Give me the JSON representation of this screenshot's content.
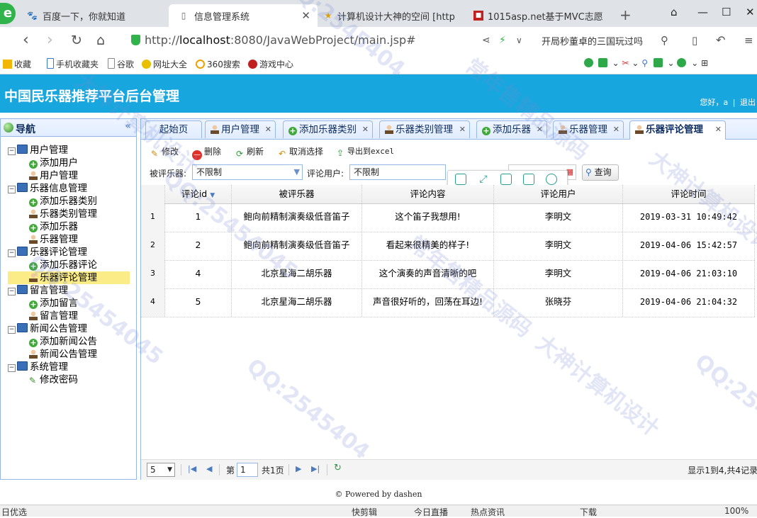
{
  "browser": {
    "tabs": [
      {
        "title": "百度一下，你就知道",
        "icon": "paw-icon"
      },
      {
        "title": "信息管理系统",
        "icon": "page-icon"
      },
      {
        "title": "计算机设计大神的空间 [http",
        "icon": "star-icon"
      },
      {
        "title": "1015asp.net基于MVC志愿",
        "icon": "site-icon"
      }
    ],
    "url_prefix": "http://",
    "url_host": "localhost",
    "url_rest": ":8080/JavaWebProject/main.jsp#",
    "search_text": "开局秒董卓的三国玩过吗",
    "bookmarks": [
      "收藏",
      "手机收藏夹",
      "谷歌",
      "网址大全",
      "360搜索",
      "游戏中心"
    ]
  },
  "app": {
    "title": "中国民乐器推荐平台后台管理",
    "greeting": "您好，a",
    "logout": "退出"
  },
  "nav": {
    "title": "导航",
    "groups": [
      {
        "label": "用户管理",
        "items": [
          {
            "label": "添加用户",
            "icon": "add-icon"
          },
          {
            "label": "用户管理",
            "icon": "user-icon"
          }
        ]
      },
      {
        "label": "乐器信息管理",
        "items": [
          {
            "label": "添加乐器类别",
            "icon": "add-icon"
          },
          {
            "label": "乐器类别管理",
            "icon": "user-icon"
          },
          {
            "label": "添加乐器",
            "icon": "add-icon"
          },
          {
            "label": "乐器管理",
            "icon": "user-icon"
          }
        ]
      },
      {
        "label": "乐器评论管理",
        "items": [
          {
            "label": "添加乐器评论",
            "icon": "add-icon"
          },
          {
            "label": "乐器评论管理",
            "icon": "user-icon",
            "selected": true
          }
        ]
      },
      {
        "label": "留言管理",
        "items": [
          {
            "label": "添加留言",
            "icon": "add-icon"
          },
          {
            "label": "留言管理",
            "icon": "user-icon"
          }
        ]
      },
      {
        "label": "新闻公告管理",
        "items": [
          {
            "label": "添加新闻公告",
            "icon": "add-icon"
          },
          {
            "label": "新闻公告管理",
            "icon": "user-icon"
          }
        ]
      },
      {
        "label": "系统管理",
        "items": [
          {
            "label": "修改密码",
            "icon": "pencil-icon"
          }
        ]
      }
    ]
  },
  "tabs": [
    {
      "label": "起始页",
      "closable": false
    },
    {
      "label": "用户管理",
      "closable": true
    },
    {
      "label": "添加乐器类别",
      "closable": true
    },
    {
      "label": "乐器类别管理",
      "closable": true
    },
    {
      "label": "添加乐器",
      "closable": true
    },
    {
      "label": "乐器管理",
      "closable": true
    },
    {
      "label": "乐器评论管理",
      "closable": true,
      "active": true
    }
  ],
  "toolbar": {
    "edit": "修改",
    "delete": "删除",
    "refresh": "刷新",
    "unselect": "取消选择",
    "export": "导出到excel"
  },
  "filters": {
    "instrument_label": "被评乐器:",
    "instrument_value": "不限制",
    "user_label": "评论用户:",
    "user_value": "不限制",
    "query": "查询"
  },
  "grid": {
    "columns": [
      "评论id",
      "被评乐器",
      "评论内容",
      "评论用户",
      "评论时间"
    ],
    "sort_column": "评论id",
    "rows": [
      {
        "num": "1",
        "id": "1",
        "instrument": "鲍向前精制演奏级低音笛子",
        "content": "这个笛子我想用!",
        "user": "李明文",
        "time": "2019-03-31 10:49:42"
      },
      {
        "num": "2",
        "id": "2",
        "instrument": "鲍向前精制演奏级低音笛子",
        "content": "看起来很精美的样子!",
        "user": "李明文",
        "time": "2019-04-06 15:42:57"
      },
      {
        "num": "3",
        "id": "4",
        "instrument": "北京星海二胡乐器",
        "content": "这个演奏的声音清晰的吧",
        "user": "李明文",
        "time": "2019-04-06 21:03:10"
      },
      {
        "num": "4",
        "id": "5",
        "instrument": "北京星海二胡乐器",
        "content": "声音很好听的，回荡在耳边!",
        "user": "张晓芬",
        "time": "2019-04-06 21:04:32"
      }
    ]
  },
  "pager": {
    "page_size": "5",
    "page_label_pre": "第",
    "page_value": "1",
    "page_label_post": "共1页",
    "summary": "显示1到4,共4记录"
  },
  "footer": "© Powered by dashen",
  "statusbar": {
    "left": "日优选",
    "items": [
      "快剪辑",
      "今日直播",
      "热点资讯",
      "下载",
      "100%"
    ]
  },
  "watermarks": [
    "QQ:2545404",
    "大神计算机设计",
    "常年售精品源码",
    "QQ:25454045",
    "大神计算机设计",
    "QQ:25454045",
    "常年售精品源码",
    "QQ:2545404",
    "大神计算机设计",
    "QQ:25454045"
  ]
}
